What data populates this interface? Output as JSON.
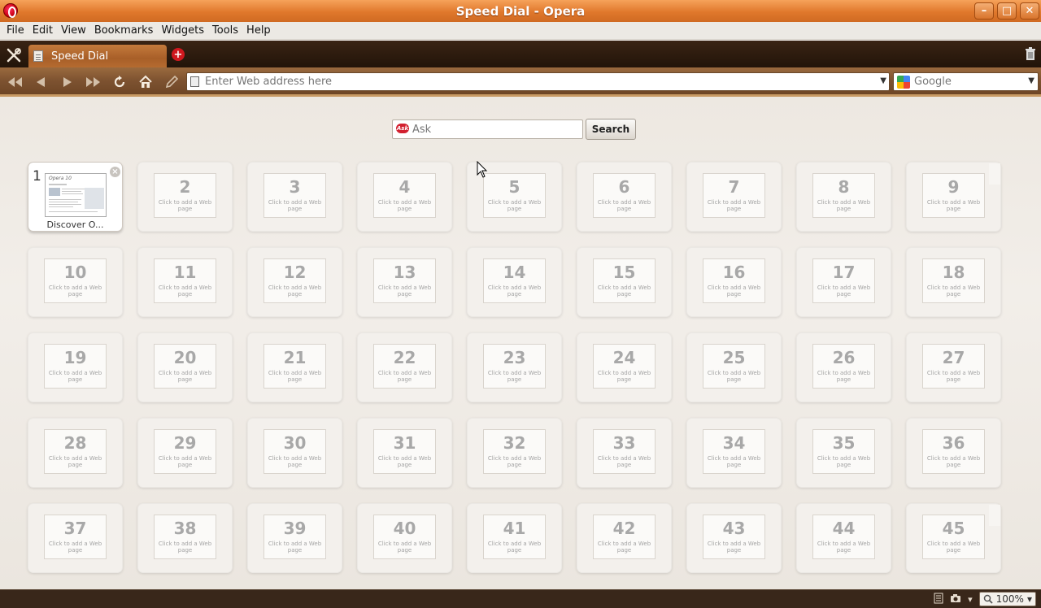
{
  "window": {
    "title": "Speed Dial - Opera"
  },
  "menu": [
    "File",
    "Edit",
    "View",
    "Bookmarks",
    "Widgets",
    "Tools",
    "Help"
  ],
  "tab": {
    "label": "Speed Dial"
  },
  "address": {
    "placeholder": "Enter Web address here",
    "search_engine": "Google"
  },
  "search": {
    "placeholder": "Ask",
    "button": "Search",
    "logo": "Ask"
  },
  "speed_dial": {
    "first": {
      "number": "1",
      "label": "Discover O..."
    },
    "empty_hint": "Click to add a Web page",
    "numbers": [
      "2",
      "3",
      "4",
      "5",
      "6",
      "7",
      "8",
      "9",
      "10",
      "11",
      "12",
      "13",
      "14",
      "15",
      "16",
      "17",
      "18",
      "19",
      "20",
      "21",
      "22",
      "23",
      "24",
      "25",
      "26",
      "27",
      "28",
      "29",
      "30",
      "31",
      "32",
      "33",
      "34",
      "35",
      "36",
      "37",
      "38",
      "39",
      "40",
      "41",
      "42",
      "43",
      "44",
      "45"
    ]
  },
  "status": {
    "zoom": "100%"
  }
}
